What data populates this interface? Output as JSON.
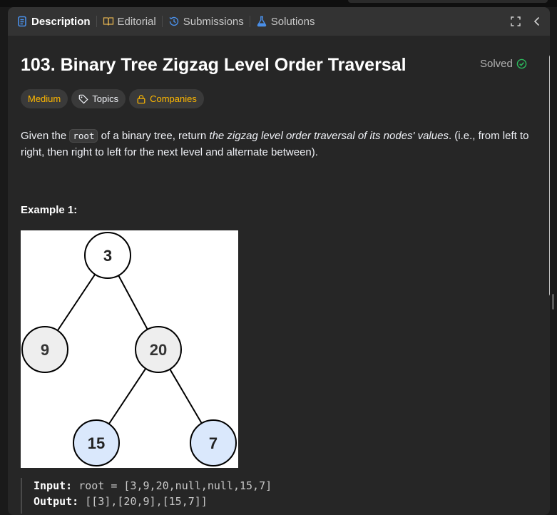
{
  "tabs": [
    {
      "label": "Description",
      "icon": "description-icon",
      "active": true
    },
    {
      "label": "Editorial",
      "icon": "book-icon",
      "active": false
    },
    {
      "label": "Submissions",
      "icon": "history-icon",
      "active": false
    },
    {
      "label": "Solutions",
      "icon": "flask-icon",
      "active": false
    }
  ],
  "problem": {
    "title": "103. Binary Tree Zigzag Level Order Traversal",
    "status": "Solved",
    "difficulty": "Medium",
    "topics_label": "Topics",
    "companies_label": "Companies",
    "description": {
      "part1": "Given the ",
      "code": "root",
      "part2": " of a binary tree, return ",
      "emphasis": "the zigzag level order traversal of its nodes' values",
      "part3": ". (i.e., from left to right, then right to left for the next level and alternate between)."
    },
    "example_title": "Example 1:",
    "tree_nodes": [
      {
        "id": "node-3",
        "value": "3",
        "highlight": false
      },
      {
        "id": "node-9",
        "value": "9",
        "highlight": false
      },
      {
        "id": "node-20",
        "value": "20",
        "highlight": false
      },
      {
        "id": "node-15",
        "value": "15",
        "highlight": true
      },
      {
        "id": "node-7",
        "value": "7",
        "highlight": true
      }
    ],
    "input_label": "Input:",
    "input_value": "root = [3,9,20,null,null,15,7]",
    "output_label": "Output:",
    "output_value": "[[3],[20,9],[15,7]]"
  },
  "colors": {
    "accent_blue": "#4a8fe8",
    "difficulty_medium": "#ffb800",
    "solved_green": "#2cbb5d",
    "node_fill": "#eeeeee",
    "node_highlight": "#dae8fc"
  }
}
